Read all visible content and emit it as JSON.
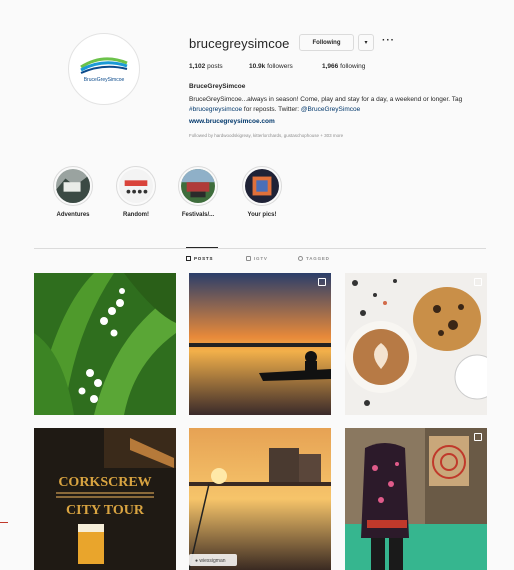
{
  "profile": {
    "username": "brucegreysimcoe",
    "follow_label": "Following",
    "chevron_label": "▾",
    "more_label": "···",
    "avatar_brand": "BruceGreySimcoe",
    "stats": {
      "posts_value": "1,102",
      "posts_label": "posts",
      "followers_value": "10.9k",
      "followers_label": "followers",
      "following_value": "1,966",
      "following_label": "following"
    },
    "bio": {
      "name": "BruceGreySimcoe",
      "text_part1": "BruceGreySimcoe...always in season! Come, play and stay for a day, a weekend or longer. Tag ",
      "hashtag": "#brucegreysimcoe",
      "text_part2": " for reposts. Twitter: ",
      "twitter": "@BruceGreySimcoe",
      "url": "www.brucegreysimcoe.com",
      "followed_by": "Followed by hardwoodskigreay, kitterlorchards, gustaschophouse + 303 more"
    }
  },
  "highlights": [
    {
      "label": "Adventures"
    },
    {
      "label": "Random!"
    },
    {
      "label": "Festivals/..."
    },
    {
      "label": "Your pics!"
    }
  ],
  "tabs": [
    {
      "label": "POSTS",
      "active": true
    },
    {
      "label": "IGTV",
      "active": false
    },
    {
      "label": "TAGGED",
      "active": false
    }
  ],
  "posts": [
    {
      "name": "lily-of-the-valley"
    },
    {
      "name": "sunset-kayak"
    },
    {
      "name": "latte-cookie"
    },
    {
      "name": "corkscrew-city-tour",
      "line1": "CORKSCREW",
      "line2": "CITY TOUR"
    },
    {
      "name": "harbour-sunset",
      "tag": "● wiessigman"
    },
    {
      "name": "axe-throwing"
    }
  ],
  "colors": {
    "link": "#00376b",
    "text": "#262626",
    "muted": "#8e8e8e",
    "border": "#dbdbdb"
  }
}
